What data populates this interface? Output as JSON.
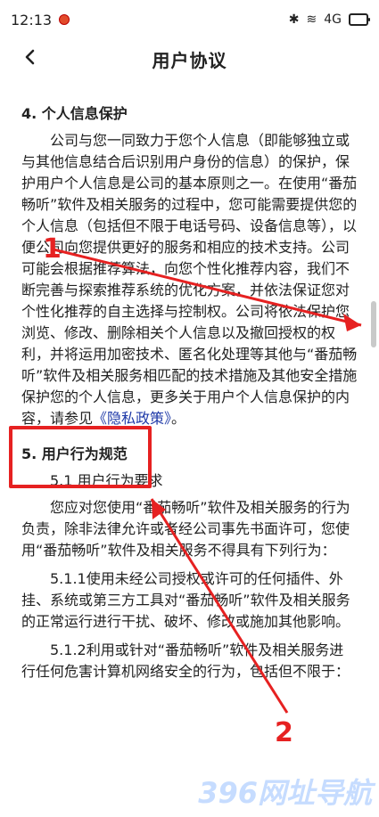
{
  "status_bar": {
    "time": "12:13",
    "signal": "4G"
  },
  "header": {
    "title": "用户协议",
    "back_icon": "chevron-left-icon"
  },
  "content": {
    "section4_title": "4. 个人信息保护",
    "section4_paragraph": "公司与您一同致力于您个人信息（即能够独立或与其他信息结合后识别用户身份的信息）的保护，保护用户个人信息是公司的基本原则之一。在使用“番茄畅听”软件及相关服务的过程中，您可能需要提供您的个人信息（包括但不限于电话号码、设备信息等），以便公司向您提供更好的服务和相应的技术支持。公司可能会根据推荐算法，向您个性化推荐内容，我们不断完善与探索推荐系统的优化方案，并依法保证您对个性化推荐的自主选择与控制权。公司将依法保护您浏览、修改、删除相关个人信息以及撤回授权的权利，并将运用加密技术、匿名化处理等其他与“番茄畅听”软件及相关服务相匹配的技术措施及其他安全措施保护您的个人信息，更多关于用户个人信息保护的内容，请参见",
    "privacy_link": "《隐私政策》",
    "privacy_suffix": "。",
    "section5_title": "5. 用户行为规范",
    "section51_title": "5.1 用户行为要求",
    "section51_paragraph": "您应对您使用“番茄畅听”软件及相关服务的行为负责，除非法律允许或者经公司事先书面许可，您使用“番茄畅听”软件及相关服务不得具有下列行为：",
    "section511": "5.1.1使用未经公司授权或许可的任何插件、外挂、系统或第三方工具对“番茄畅听”软件及相关服务的正常运行进行干扰、破坏、修改或施加其他影响。",
    "section512": "5.1.2利用或针对“番茄畅听”软件及相关服务进行任何危害计算机网络安全的行为，包括但不限于："
  },
  "annotations": {
    "marker1": "1",
    "marker2": "2",
    "box_color": "#e62121"
  },
  "watermark": "396网址导航"
}
